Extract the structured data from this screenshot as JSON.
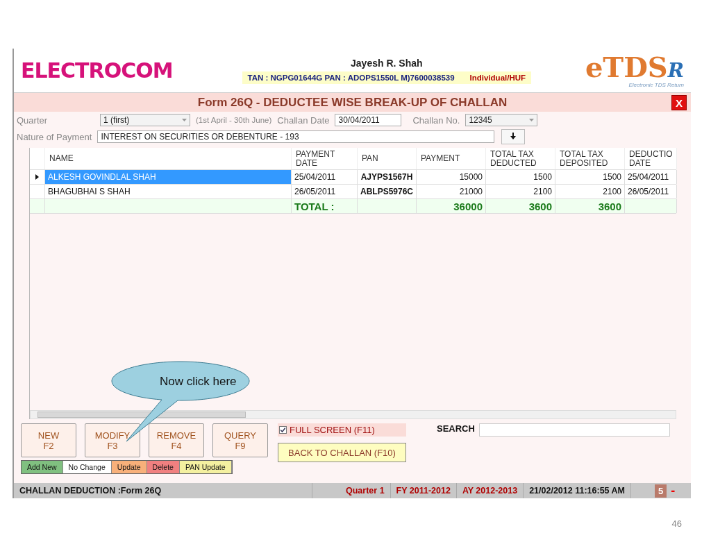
{
  "header": {
    "logo": "ELECTROCOM",
    "user": "Jayesh R. Shah",
    "ids": "TAN : NGPG01644G  PAN : ADOPS1550L  M)7600038539",
    "category": "Individual/HUF",
    "brand": {
      "main": "eTDS",
      "suffix": "R",
      "tagline": "Electronic TDS Return"
    }
  },
  "title": "Form 26Q - DEDUCTEE WISE BREAK-UP OF CHALLAN",
  "close": "X",
  "filters": {
    "quarter_label": "Quarter",
    "quarter": "1 (first)",
    "quarter_range": "(1st April - 30th June)",
    "challan_date_label": "Challan Date",
    "challan_date": "30/04/2011",
    "challan_no_label": "Challan No.",
    "challan_no": "12345",
    "nature_label": "Nature of Payment",
    "nature": "INTEREST ON SECURITIES OR DEBENTURE - 193"
  },
  "table": {
    "columns": [
      {
        "label": "NAME",
        "kind": "text"
      },
      {
        "label": "PAYMENT DATE",
        "kind": "date"
      },
      {
        "label": "PAN",
        "kind": "pan"
      },
      {
        "label": "PAYMENT",
        "kind": "number"
      },
      {
        "label": "TOTAL TAX DEDUCTED",
        "kind": "number"
      },
      {
        "label": "TOTAL TAX DEPOSITED",
        "kind": "number"
      },
      {
        "label": "DEDUCTIO DATE",
        "kind": "date"
      }
    ],
    "rows": [
      {
        "selected": true,
        "cells": [
          "ALKESH GOVINDLAL SHAH",
          "25/04/2011",
          "AJYPS1567H",
          "15000",
          "1500",
          "1500",
          "25/04/2011"
        ]
      },
      {
        "selected": false,
        "cells": [
          "BHAGUBHAI S SHAH",
          "26/05/2011",
          "ABLPS5976C",
          "21000",
          "2100",
          "2100",
          "26/05/2011"
        ]
      }
    ],
    "total": {
      "label": "TOTAL :",
      "payment": "36000",
      "deducted": "3600",
      "deposited": "3600"
    }
  },
  "callout": "Now click here",
  "buttons": [
    {
      "label": "NEW",
      "key": "F2"
    },
    {
      "label": "MODIFY",
      "key": "F3"
    },
    {
      "label": "REMOVE",
      "key": "F4"
    },
    {
      "label": "QUERY",
      "key": "F9"
    }
  ],
  "full_screen": {
    "label": "FULL SCREEN (F11)",
    "checked": true
  },
  "back_button": "BACK TO CHALLAN (F10)",
  "search": {
    "label": "SEARCH"
  },
  "legend": [
    {
      "label": "Add New",
      "color": "#80c080"
    },
    {
      "label": "No Change",
      "color": "#ffffff"
    },
    {
      "label": "Update",
      "color": "#f8b07a"
    },
    {
      "label": "Delete",
      "color": "#f08080"
    },
    {
      "label": "PAN Update",
      "color": "#f4f0a0"
    }
  ],
  "status_bar": {
    "screen": "CHALLAN DEDUCTION :Form 26Q",
    "quarter": "Quarter 1",
    "fy": "FY 2011-2012",
    "ay": "AY 2012-2013",
    "datetime": "21/02/2012 11:16:55 AM",
    "count": "5",
    "minimize": "-"
  },
  "page_number": "46"
}
